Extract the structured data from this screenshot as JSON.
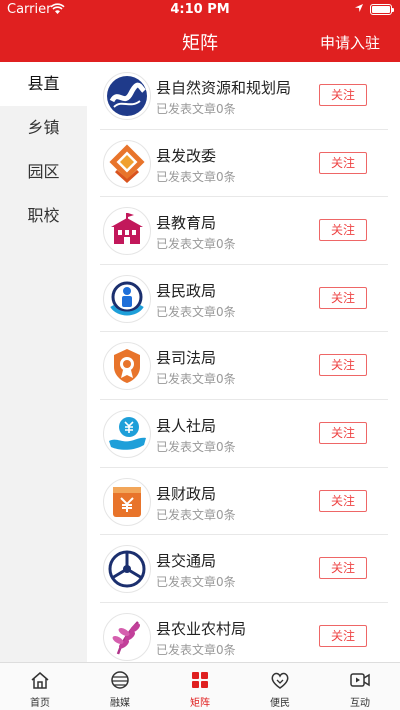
{
  "status_bar": {
    "carrier": "Carrier",
    "time": "4:10 PM"
  },
  "nav": {
    "title": "矩阵",
    "apply_label": "申请入驻"
  },
  "sidebar": {
    "items": [
      {
        "label": "县直",
        "active": true
      },
      {
        "label": "乡镇",
        "active": false
      },
      {
        "label": "园区",
        "active": false
      },
      {
        "label": "职校",
        "active": false
      }
    ]
  },
  "follow_label": "关注",
  "accounts": [
    {
      "name": "县自然资源和规划局",
      "count": "已发表文章0条",
      "icon": "natural-resources-logo"
    },
    {
      "name": "县发改委",
      "count": "已发表文章0条",
      "icon": "development-reform-logo"
    },
    {
      "name": "县教育局",
      "count": "已发表文章0条",
      "icon": "education-logo"
    },
    {
      "name": "县民政局",
      "count": "已发表文章0条",
      "icon": "civil-affairs-logo"
    },
    {
      "name": "县司法局",
      "count": "已发表文章0条",
      "icon": "justice-logo"
    },
    {
      "name": "县人社局",
      "count": "已发表文章0条",
      "icon": "human-resources-logo"
    },
    {
      "name": "县财政局",
      "count": "已发表文章0条",
      "icon": "finance-logo"
    },
    {
      "name": "县交通局",
      "count": "已发表文章0条",
      "icon": "transport-logo"
    },
    {
      "name": "县农业农村局",
      "count": "已发表文章0条",
      "icon": "agriculture-logo"
    }
  ],
  "tabbar": {
    "items": [
      {
        "label": "首页",
        "icon": "home-icon",
        "active": false
      },
      {
        "label": "融媒",
        "icon": "media-icon",
        "active": false
      },
      {
        "label": "矩阵",
        "icon": "matrix-icon",
        "active": true
      },
      {
        "label": "便民",
        "icon": "heart-icon",
        "active": false
      },
      {
        "label": "互动",
        "icon": "video-icon",
        "active": false
      }
    ]
  },
  "colors": {
    "brand": "#e02020",
    "follow_border": "#e66666",
    "sidebar_bg": "#f2f2f2"
  }
}
